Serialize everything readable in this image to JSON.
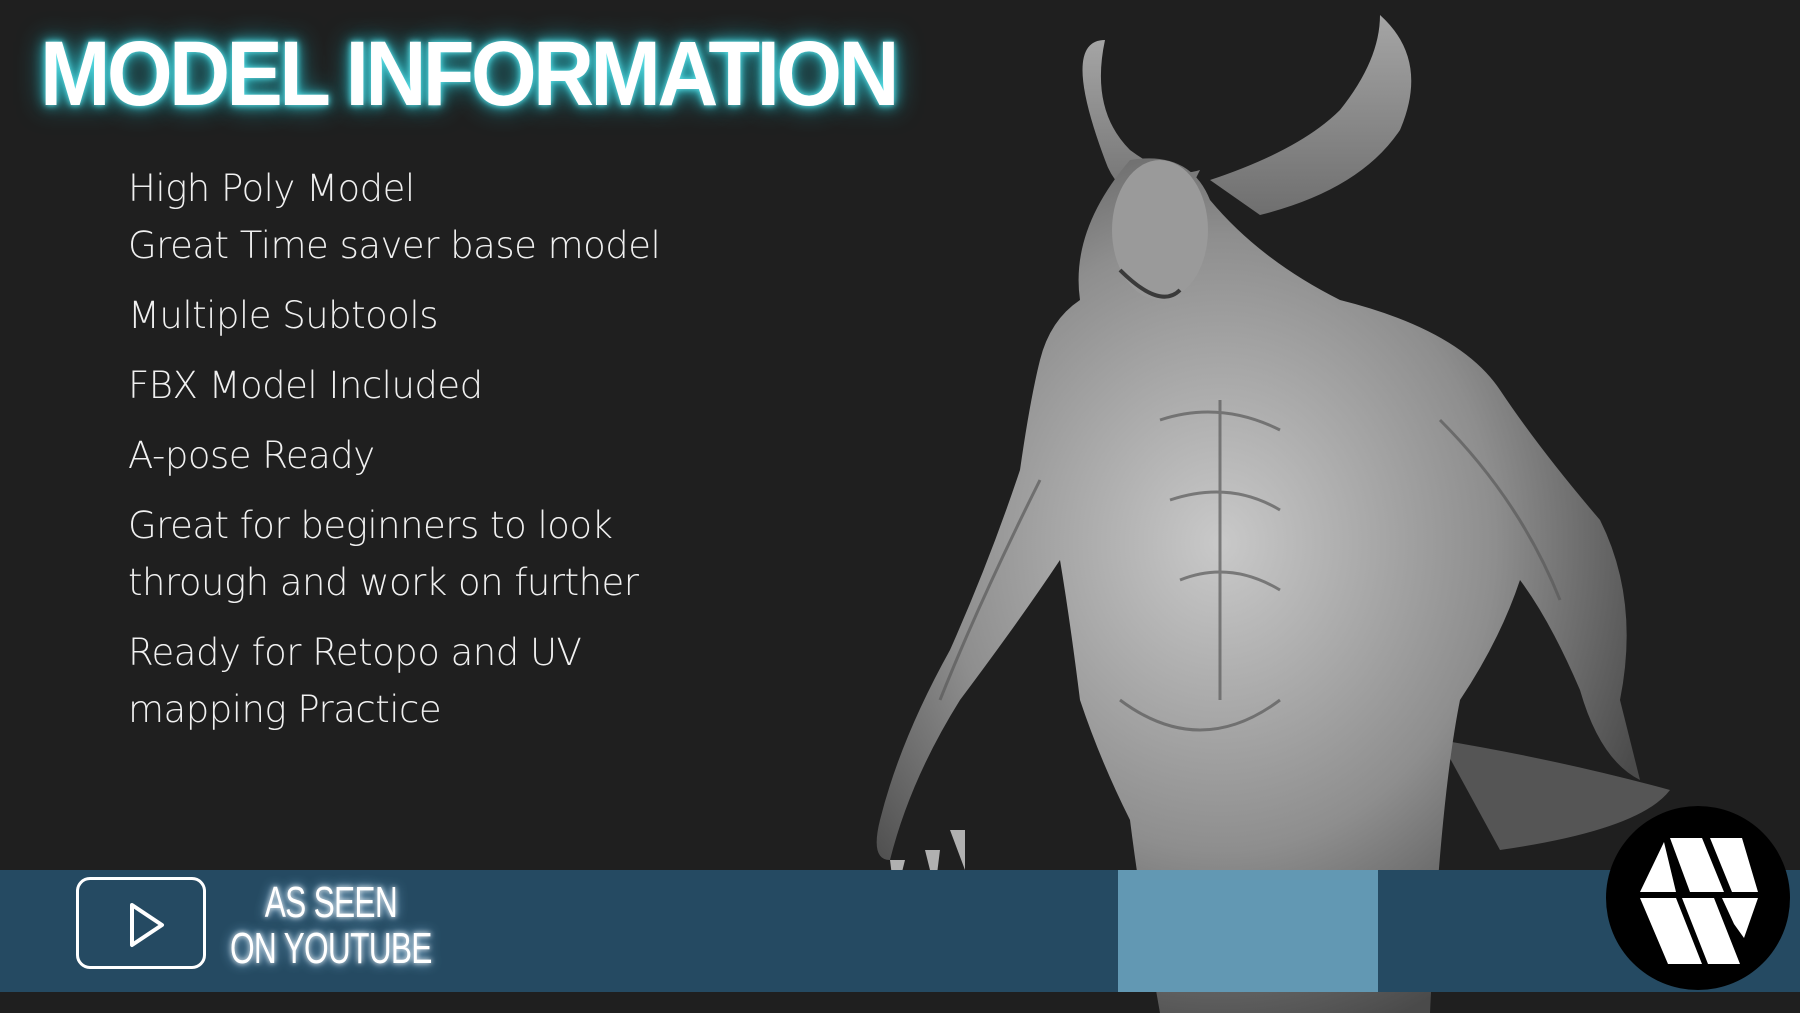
{
  "title": "MODEL INFORMATION",
  "features": [
    "High Poly Model",
    "Great Time saver base model",
    "Multiple Subtools",
    "FBX Model Included",
    "A-pose Ready",
    "Great for beginners to look",
    "through and work on further",
    "Ready for Retopo and UV",
    "mapping Practice"
  ],
  "badge": {
    "line1": "AS SEEN",
    "line2": "ON YOUTUBE",
    "icon": "play-icon"
  },
  "illustration": "horned-demon-sculpt",
  "logo": "brand-logo",
  "colors": {
    "background": "#1f1f1f",
    "band": "#254a62",
    "title_glow": "#37c6d0",
    "text": "#ffffff"
  }
}
